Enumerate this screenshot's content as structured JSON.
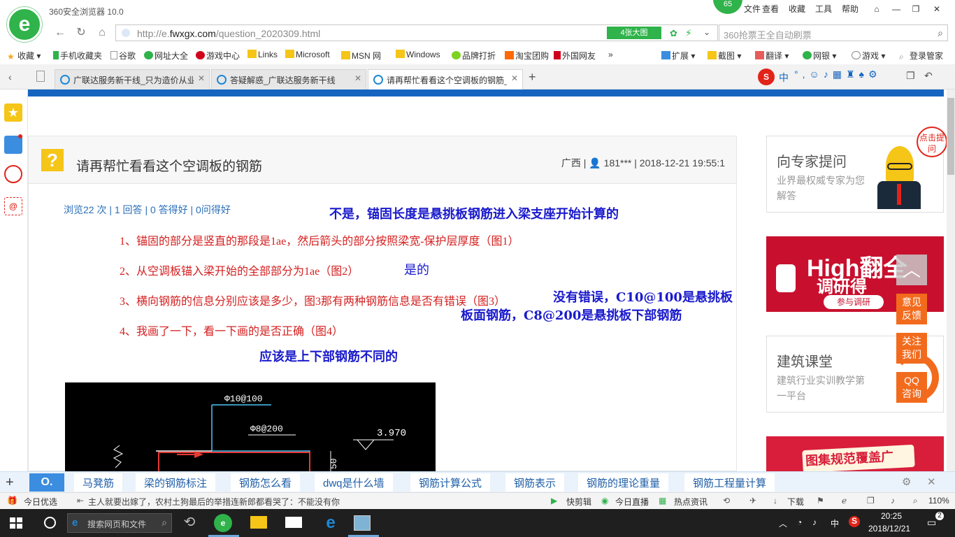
{
  "window": {
    "title": "360安全浏览器 10.0",
    "score": "65",
    "menu": [
      "文件",
      "查看",
      "收藏",
      "工具",
      "帮助"
    ]
  },
  "address": {
    "url_prefix": "http://e.",
    "url_domain": "fwxgx.com",
    "url_path": "/question_2020309.html",
    "big_pic": "4张大图",
    "search_placeholder": "360抢票王全自动刷票"
  },
  "bookmarks": [
    {
      "label": "收藏",
      "color": "#f5a623"
    },
    {
      "label": "手机收藏夹",
      "color": "#2fb34a"
    },
    {
      "label": "谷歌",
      "color": "#999999"
    },
    {
      "label": "网址大全",
      "color": "#2fb34a"
    },
    {
      "label": "游戏中心",
      "color": "#d0021b"
    },
    {
      "label": "Links",
      "color": "#f5c518"
    },
    {
      "label": "Microsoft",
      "color": "#f5c518"
    },
    {
      "label": "MSN 网",
      "color": "#f5c518"
    },
    {
      "label": "Windows",
      "color": "#f5c518"
    },
    {
      "label": "品牌打折",
      "color": "#7ed321"
    },
    {
      "label": "淘宝团购",
      "color": "#ff6a00"
    },
    {
      "label": "外国网友",
      "color": "#d0021b"
    }
  ],
  "toolbar_right": [
    "扩展",
    "截图",
    "翻译",
    "网银",
    "游戏",
    "登录管家"
  ],
  "tabs": [
    {
      "label": "广联达服务新干线_只为造价从业",
      "active": false
    },
    {
      "label": "答疑解惑_广联达服务新干线",
      "active": false
    },
    {
      "label": "请再帮忙看看这个空调板的钢筋_",
      "active": true
    }
  ],
  "question": {
    "title": "请再帮忙看看这个空调板的钢筋",
    "region": "广西",
    "user": "181***",
    "datetime": "2018-12-21 19:55:1",
    "stats": "浏览22 次 | 1 回答 | 0 答得好 | 0问得好",
    "lines": [
      "1、锚固的部分是竖直的那段是1ae，然后箭头的部分按照梁宽-保护层厚度（图1）",
      "2、从空调板锚入梁开始的全部部分为1ae（图2）",
      "3、横向钢筋的信息分别应该是多少，图3那有两种钢筋信息是否有错误（图3）",
      "4、我画了一下，看一下画的是否正确（图4）"
    ],
    "answers": {
      "a1": "不是，锚固长度是悬挑板钢筋进入梁支座开始计算的",
      "a2": "是的",
      "a3_line1": "没有错误，C10@100是悬挑板",
      "a3_line2": "板面钢筋，C8@200是悬挑板下部钢筋",
      "a4": "应该是上下部钢筋不同的"
    },
    "cad_labels": [
      "Φ10@100",
      "Φ8@200",
      "3.970",
      "50"
    ]
  },
  "sidebar": {
    "expert_title": "向专家提问",
    "expert_sub": "业界最权威专家为您解答",
    "expert_tag": "点击提问",
    "banner1": "High翻全",
    "banner1_sub": "调研得",
    "banner1_btn": "参与调研",
    "school_title": "建筑课堂",
    "school_sub": "建筑行业实训教学第一平台",
    "banner2": "图集规范覆盖广",
    "float_feedback": "意见反馈",
    "float_follow": "关注我们",
    "float_qq": "QQ咨询"
  },
  "related": [
    "马凳筋",
    "梁的钢筋标注",
    "钢筋怎么看",
    "dwq是什么墙",
    "钢筋计算公式",
    "钢筋表示",
    "钢筋的理论重量",
    "钢筋工程量计算"
  ],
  "status": {
    "today_pick": "今日优选",
    "news": "主人就要出嫁了，农村土狗最后的举措连新郎都看哭了：不能没有你",
    "items": [
      "快剪辑",
      "今日直播",
      "热点资讯",
      "下载"
    ],
    "zoom": "110%"
  },
  "taskbar": {
    "search": "搜索网页和文件",
    "ime": "中",
    "time": "20:25",
    "date": "2018/12/21",
    "notif": "2"
  },
  "colors": {
    "brand_green": "#2fb34a",
    "answer_blue": "#1a1acc",
    "question_red": "#d42020",
    "band_blue": "#1565c0",
    "link_blue": "#2a6ebb"
  }
}
